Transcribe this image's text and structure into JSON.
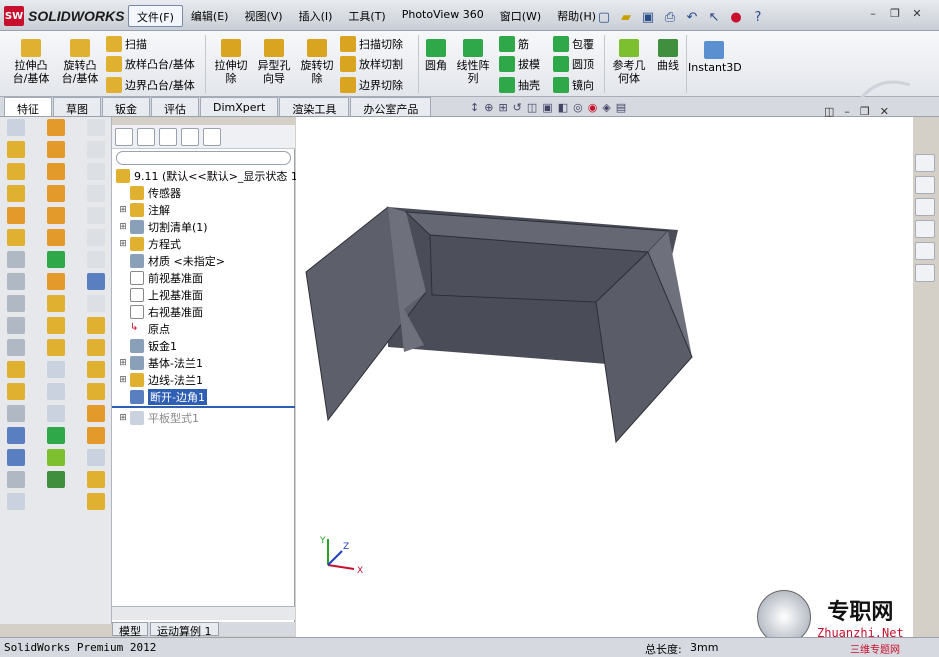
{
  "app": {
    "brand": "SOLIDWORKS",
    "brand_badge": "SW"
  },
  "menu": [
    "文件(F)",
    "编辑(E)",
    "视图(V)",
    "插入(I)",
    "工具(T)",
    "PhotoView 360",
    "窗口(W)",
    "帮助(H)"
  ],
  "ribbon": {
    "extrude_boss": "拉伸凸\n台/基体",
    "revolve_boss": "旋转凸\n台/基体",
    "sweep": "扫描",
    "loft_boss": "放样凸台/基体",
    "boundary_boss": "边界凸台/基体",
    "extrude_cut": "拉伸切\n除",
    "hole_wizard": "异型孔\n向导",
    "revolve_cut": "旋转切\n除",
    "swept_cut": "扫描切除",
    "lofted_cut": "放样切割",
    "boundary_cut": "边界切除",
    "fillet": "圆角",
    "linear_pattern": "线性阵\n列",
    "rib": "筋",
    "draft": "拔模",
    "shell": "抽壳",
    "wrap": "包覆",
    "dome": "圆顶",
    "mirror": "镜向",
    "ref_geometry": "参考几\n何体",
    "curves": "曲线",
    "instant3d": "Instant3D"
  },
  "tabs": [
    "特征",
    "草图",
    "钣金",
    "评估",
    "DimXpert",
    "渲染工具",
    "办公室产品"
  ],
  "tree": {
    "root": "9.11  (默认<<默认>_显示状态 1",
    "items": [
      "传感器",
      "注解",
      "切割清单(1)",
      "方程式",
      "材质 <未指定>",
      "前视基准面",
      "上视基准面",
      "右视基准面",
      "原点",
      "钣金1",
      "基体-法兰1",
      "边线-法兰1",
      "断开-边角1",
      "平板型式1"
    ]
  },
  "tree_tabs": [
    "模型",
    "运动算例 1"
  ],
  "status": {
    "product": "SolidWorks Premium 2012",
    "total_length_label": "总长度:",
    "total_length_value": "3mm"
  },
  "watermark": {
    "title": "专职网",
    "url": "Zhuanzhi.Net",
    "tagline": "三维专题网"
  },
  "axes": {
    "x": "X",
    "y": "Y",
    "z": "Z"
  },
  "colors": {
    "part": "#5a5d68",
    "selected": "#2f5fb4",
    "brand": "#c8102e"
  }
}
